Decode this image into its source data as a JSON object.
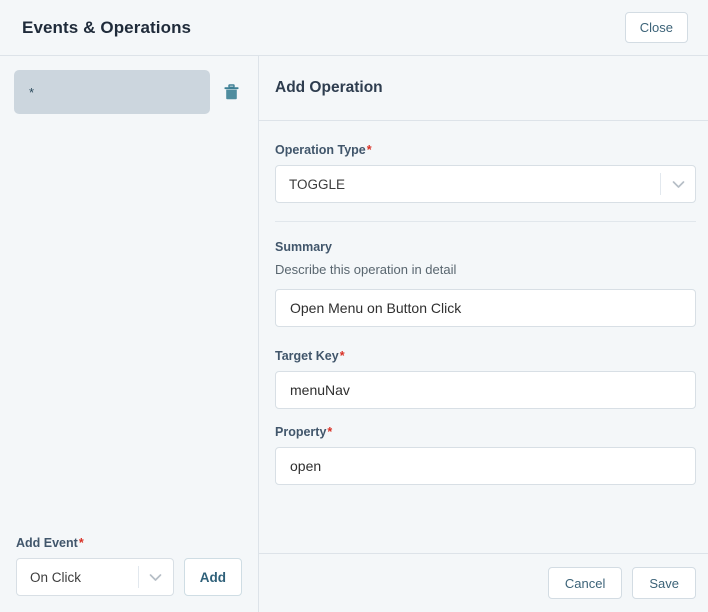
{
  "header": {
    "title": "Events & Operations",
    "close_label": "Close"
  },
  "left_panel": {
    "events": [
      {
        "label": "*",
        "delete_icon": "trash-icon"
      }
    ],
    "add_event": {
      "label": "Add Event",
      "required_marker": "*",
      "selected_option": "On Click",
      "dropdown_icon": "chevron-down-icon",
      "add_button_label": "Add"
    }
  },
  "right_panel": {
    "title": "Add Operation",
    "fields": {
      "operation_type": {
        "label": "Operation Type",
        "required_marker": "*",
        "value": "TOGGLE",
        "dropdown_icon": "chevron-down-icon"
      },
      "summary": {
        "label": "Summary",
        "helper": "Describe this operation in detail",
        "value": "Open Menu on Button Click"
      },
      "target_key": {
        "label": "Target Key",
        "required_marker": "*",
        "value": "menuNav"
      },
      "property": {
        "label": "Property",
        "required_marker": "*",
        "value": "open"
      }
    },
    "footer": {
      "cancel_label": "Cancel",
      "save_label": "Save"
    }
  },
  "colors": {
    "background": "#f4f7f9",
    "border": "#dde3e9",
    "selected_item": "#ccd6de",
    "accent_teal": "#3c7f94",
    "required_red": "#d93025",
    "title_text": "#1f2b3a"
  }
}
